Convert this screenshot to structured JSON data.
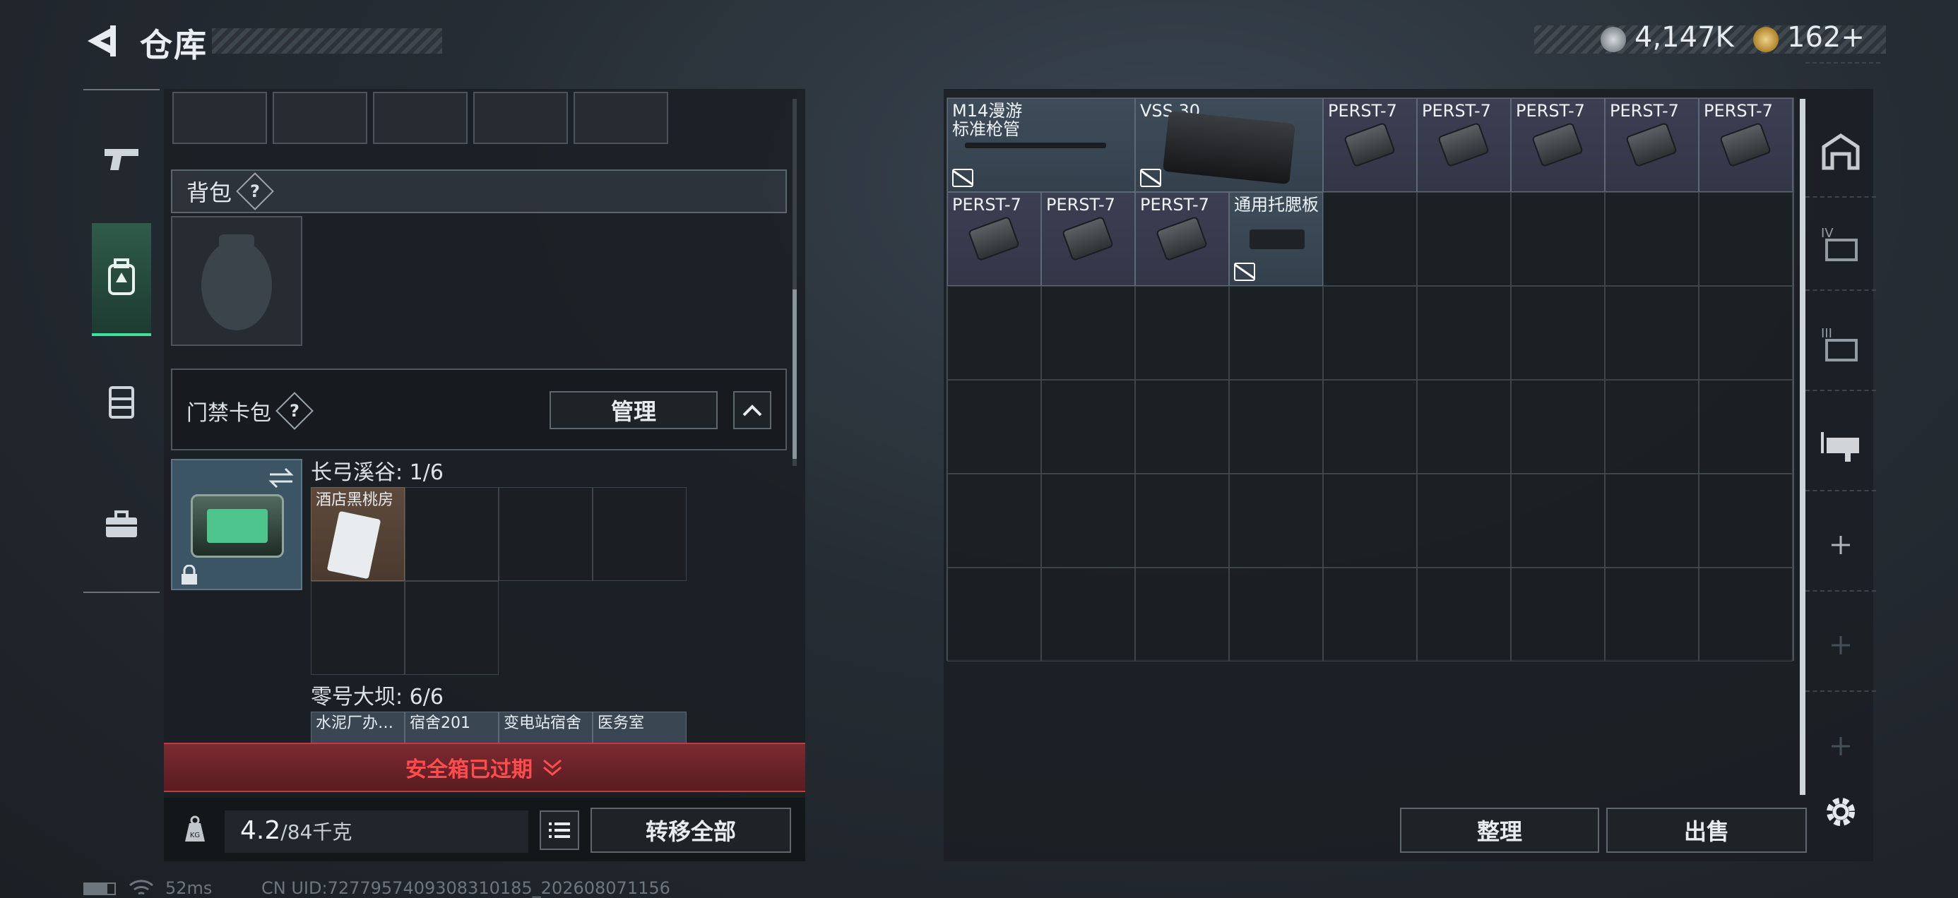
{
  "header": {
    "title": "仓库",
    "currency1": "4,147K",
    "currency2": "162+",
    "icons": [
      "back-arrow-icon",
      "silver-coin-icon",
      "gold-coin-icon"
    ]
  },
  "left_nav": {
    "icons": [
      "pistol-icon",
      "backpack-icon",
      "rig-icon",
      "briefcase-icon"
    ],
    "active": "backpack-icon"
  },
  "backpack": {
    "label": "背包",
    "help": "?"
  },
  "keycard": {
    "label": "门禁卡包",
    "help": "?",
    "manage": "管理"
  },
  "map1": {
    "label": "长弓溪谷: 1/6",
    "cards": [
      "酒店黑桃房"
    ]
  },
  "map2": {
    "label": "零号大坝: 6/6",
    "cards": [
      "水泥厂办…",
      "宿舍201",
      "变电站宿舍",
      "医务室"
    ]
  },
  "safe_banner": "安全箱已过期",
  "weight": {
    "current": "4.2",
    "capacity": "/84千克",
    "kg_badge": "KG"
  },
  "transfer_all": "转移全部",
  "stash": {
    "items": [
      {
        "name": "M14漫游\n标准枪管",
        "color": "blue"
      },
      {
        "name": "VSS 30",
        "color": "blue"
      },
      {
        "name": "PERST-7",
        "color": "purple"
      },
      {
        "name": "PERST-7",
        "color": "purple"
      },
      {
        "name": "PERST-7",
        "color": "purple"
      },
      {
        "name": "PERST-7",
        "color": "purple"
      },
      {
        "name": "PERST-7",
        "color": "purple"
      },
      {
        "name": "PERST-7",
        "color": "purple"
      },
      {
        "name": "PERST-7",
        "color": "purple"
      },
      {
        "name": "PERST-7",
        "color": "purple"
      },
      {
        "name": "通用托腮板",
        "color": "blue"
      }
    ]
  },
  "buttons": {
    "sort": "整理",
    "sell": "出售"
  },
  "right_nav": {
    "icons": [
      "stash-home-icon",
      "tab-iv-icon",
      "tab-iii-icon",
      "tab-active-icon",
      "add-icon",
      "add-icon",
      "add-icon",
      "settings-icon"
    ]
  },
  "footer": {
    "ping": "52ms",
    "uid": "CN UID:7277957409308310185_202608071156"
  }
}
